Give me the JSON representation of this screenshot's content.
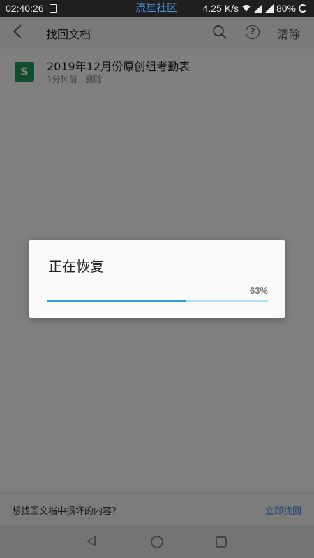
{
  "status_bar": {
    "time": "02:40:26",
    "watermark": "流星社区",
    "speed": "4.25 K/s",
    "battery": "80%"
  },
  "app_bar": {
    "title": "找回文档",
    "clear_label": "清除",
    "help_glyph": "?"
  },
  "file": {
    "icon_letter": "S",
    "icon_color": "#1e9d58",
    "name": "2019年12月份原创组考勤表",
    "time_ago": "1分钟前",
    "status": "删除"
  },
  "bottom": {
    "question": "想找回文档中损坏的内容?",
    "action": "立即找回"
  },
  "dialog": {
    "title": "正在恢复",
    "percent_label": "63%",
    "progress": 0.63
  },
  "colors": {
    "accent": "#2e9ae4",
    "link": "#3a8ee6"
  }
}
